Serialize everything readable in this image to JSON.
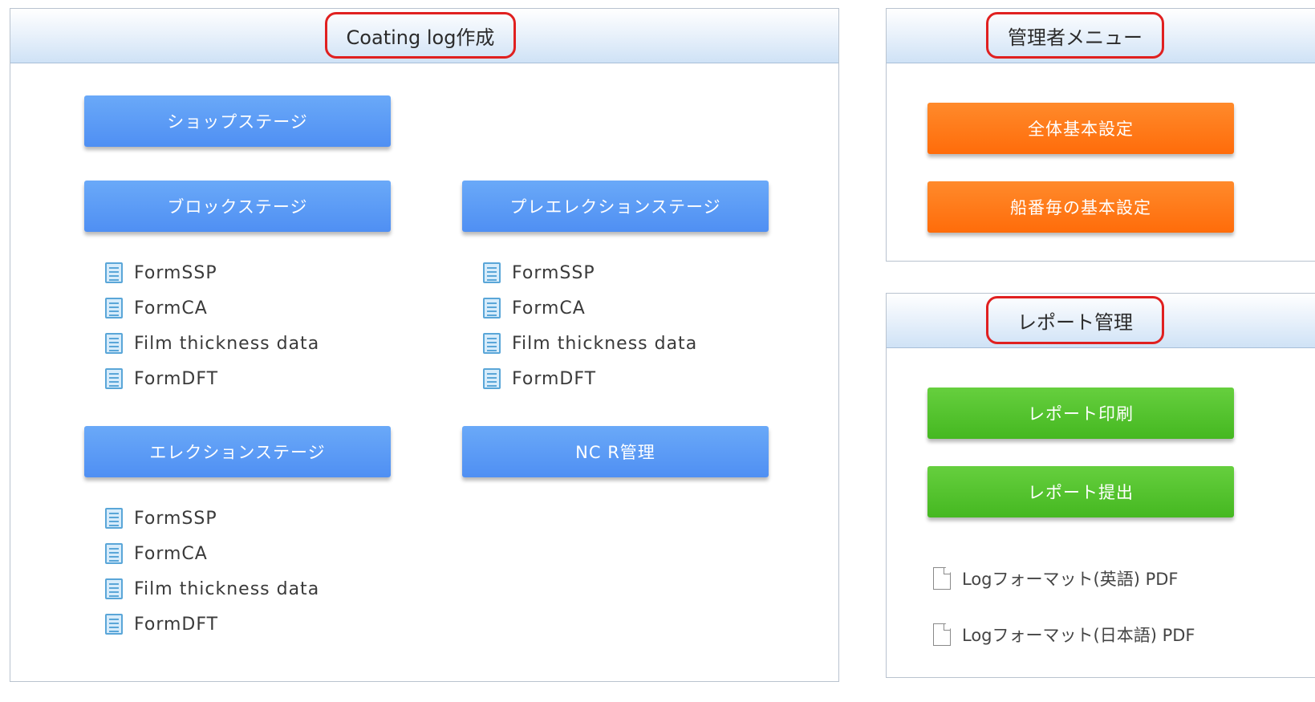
{
  "coating_panel": {
    "title": "Coating log作成",
    "shop_stage": "ショップステージ",
    "block_stage": "ブロックステージ",
    "pre_erection_stage": "プレエレクションステージ",
    "erection_stage": "エレクションステージ",
    "ncr": "NC R管理",
    "block_forms": [
      "FormSSP",
      "FormCA",
      "Film thickness data",
      "FormDFT"
    ],
    "pre_erection_forms": [
      "FormSSP",
      "FormCA",
      "Film thickness data",
      "FormDFT"
    ],
    "erection_forms": [
      "FormSSP",
      "FormCA",
      "Film thickness data",
      "FormDFT"
    ]
  },
  "admin_panel": {
    "title": "管理者メニュー",
    "overall_settings": "全体基本設定",
    "ship_settings": "船番毎の基本設定"
  },
  "report_panel": {
    "title": "レポート管理",
    "print": "レポート印刷",
    "submit": "レポート提出",
    "pdf_english": "Logフォーマット(英語) PDF",
    "pdf_japanese": "Logフォーマット(日本語) PDF"
  },
  "colors": {
    "blue_button": "#5a9bf6",
    "orange_button": "#ff7a1a",
    "green_button": "#52c22b",
    "highlight_border": "#e02020",
    "header_gradient": "#d6e6f7"
  },
  "icons": {
    "form_item": "document-lines-icon",
    "pdf_item": "file-icon"
  }
}
